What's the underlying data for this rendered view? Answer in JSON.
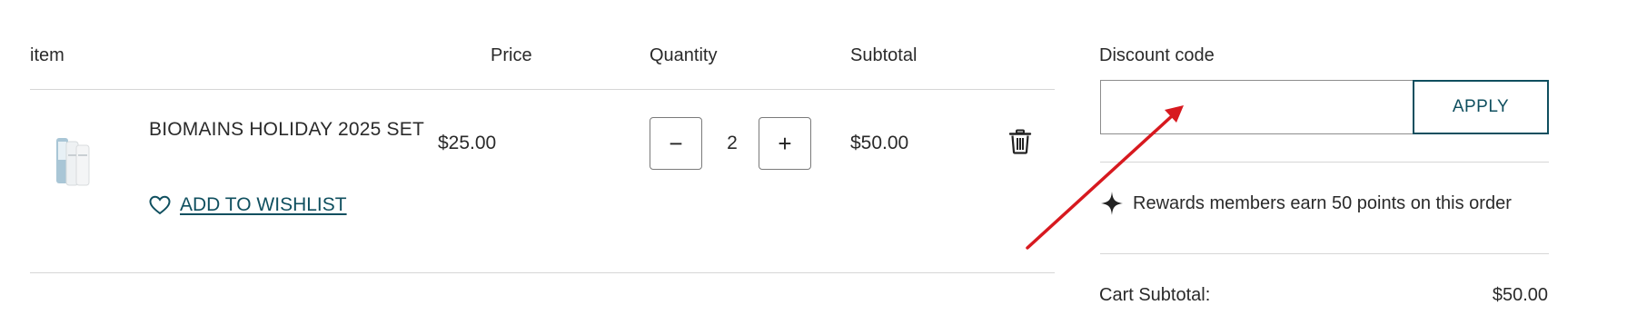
{
  "table": {
    "headers": {
      "item": "item",
      "price": "Price",
      "quantity": "Quantity",
      "subtotal": "Subtotal"
    }
  },
  "cart_item": {
    "name": "BIOMAINS HOLIDAY 2025 SET",
    "price": "$25.00",
    "quantity": "2",
    "subtotal": "$50.00",
    "decrement_label": "−",
    "increment_label": "+",
    "wishlist_label": "ADD TO WISHLIST"
  },
  "discount": {
    "label": "Discount code",
    "input_value": "",
    "apply_label": "APPLY"
  },
  "rewards": {
    "text": "Rewards members earn 50 points on this order"
  },
  "summary": {
    "cart_subtotal_label": "Cart Subtotal:",
    "cart_subtotal_value": "$50.00"
  },
  "icons": {
    "wishlist": "heart-icon",
    "remove": "trash-icon",
    "rewards": "sparkle-icon"
  },
  "colors": {
    "accent": "#0f4f5f",
    "annotation_arrow": "#d7191f",
    "divider": "#d6d6d6"
  }
}
